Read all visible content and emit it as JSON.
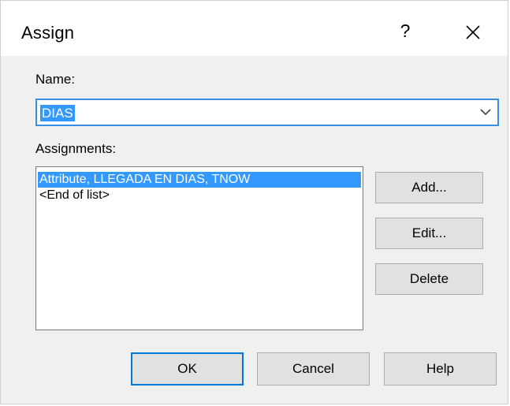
{
  "dialog": {
    "title": "Assign",
    "help_symbol": "?",
    "icons": {
      "help": "question-icon",
      "close": "close-icon",
      "dropdown": "chevron-down-icon"
    }
  },
  "name_field": {
    "label": "Name:",
    "value": "DIAS"
  },
  "assignments": {
    "label": "Assignments:",
    "items": [
      "Attribute, LLEGADA EN DIAS, TNOW",
      "<End of list>"
    ],
    "selected_index": 0
  },
  "side_buttons": {
    "add": "Add...",
    "edit": "Edit...",
    "delete": "Delete"
  },
  "bottom_buttons": {
    "ok": "OK",
    "cancel": "Cancel",
    "help": "Help"
  },
  "colors": {
    "selection": "#3399ff",
    "focus_border": "#0078d7"
  }
}
